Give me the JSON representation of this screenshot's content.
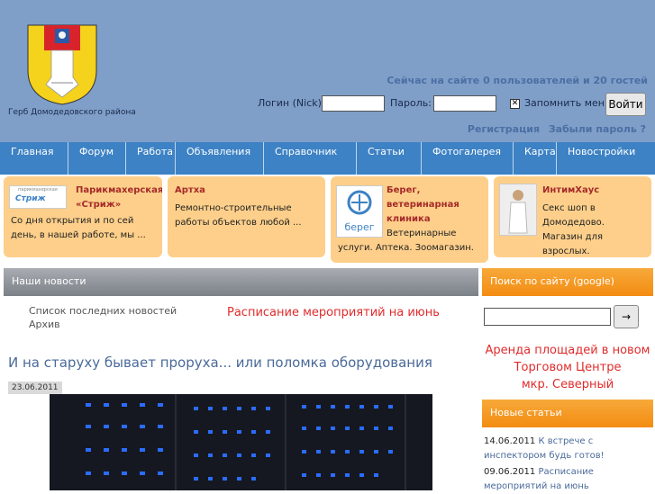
{
  "header": {
    "coat_caption": "Герб Домодедовского района",
    "online": "Сейчас на сайте 0 пользователей и 20 гостей",
    "login_label": "Логин (Nick):",
    "password_label": "Пароль:",
    "remember_label": "Запомнить меня",
    "login_button": "Войти",
    "register_link": "Регистрация",
    "forgot_link": "Забыли пароль ?"
  },
  "nav": [
    "Главная",
    "Форум",
    "Работа",
    "Объявления",
    "Справочник",
    "Статьи",
    "Фотогалерея",
    "Карта",
    "Новостройки"
  ],
  "promos": [
    {
      "title": "Парикмахерская «Стриж»",
      "text": "Со дня открытия и по сей день, в нашей работе, мы ...",
      "logo": "Стриж",
      "logo_small": "парикмахерская"
    },
    {
      "title": "Артха",
      "text": "Ремонтно-строительные работы объектов любой ..."
    },
    {
      "title": "Берег, ветеринарная клиника",
      "text": "Ветеринарные услуги. Аптека. Зоомагазин.",
      "logo": "берег"
    },
    {
      "title": "ИнтимХаус",
      "text": "Секс шоп в Домодедово. Магазин для взрослых."
    }
  ],
  "news": {
    "header": "Наши новости",
    "latest_link": "Список последних новостей",
    "archive_link": "Архив",
    "schedule_link": "Расписание мероприятий на июнь",
    "article_title": "И на старуху бывает проруха... или поломка оборудования",
    "article_date": "23.06.2011"
  },
  "sidebar": {
    "search_header": "Поиск по сайту (google)",
    "search_button": "→",
    "rent_text": [
      "Аренда площадей в новом",
      "Торговом Центре",
      "мкр. Северный"
    ],
    "new_header": "Новые статьи",
    "articles": [
      {
        "date": "14.06.2011",
        "title": "К встрече с инспектором будь готов!"
      },
      {
        "date": "09.06.2011",
        "title": "Расписание мероприятий на июнь"
      }
    ]
  },
  "colors": {
    "header_bg": "#7f9fc9",
    "nav_bg": "#3d82c4",
    "promo_bg": "#fdcf8a",
    "accent_orange": "#f38c12",
    "accent_red": "#e02b2b"
  }
}
